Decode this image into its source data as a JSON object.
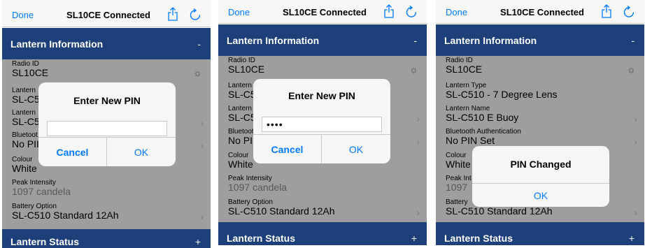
{
  "nav": {
    "done": "Done",
    "title": "SL10CE Connected",
    "share_icon": "share-icon",
    "refresh_icon": "refresh-icon"
  },
  "sections": {
    "info_label": "Lantern Information",
    "info_toggle": "-",
    "status_label": "Lantern Status",
    "status_toggle": "+"
  },
  "fields": {
    "radio_id": {
      "label": "Radio ID",
      "value": "SL10CE"
    },
    "type": {
      "label": "Lantern Type",
      "value": "SL-C510 - 7 Degree Lens"
    },
    "name": {
      "label": "Lantern Name",
      "value": "SL-C510 E Buoy"
    },
    "auth": {
      "label": "Bluetooth Authentication",
      "value": "No PIN Set"
    },
    "colour": {
      "label": "Colour",
      "value": "White"
    },
    "intensity": {
      "label": "Peak Intensity",
      "value": "1097 candela"
    },
    "battery": {
      "label": "Battery Option",
      "value": "SL-C510 Standard 12Ah"
    }
  },
  "truncated": {
    "type_label": "Lantern",
    "type_value_s1": "SL-C5",
    "type_value_s2": "SL-C5",
    "name_label": "Lantern",
    "name_value": "SL-C5",
    "auth_label": "Bluetoot",
    "auth_value_s1": "No PII",
    "auth_value_s2": "No PI",
    "colour_value_s3": "White",
    "intensity_label_s3": "Peak Int",
    "intensity_value_s3": "1097",
    "battery_label_s3": "Battery"
  },
  "dialogs": {
    "enter_pin": {
      "title": "Enter New PIN",
      "value_empty": "",
      "value_filled": "••••",
      "cancel": "Cancel",
      "ok": "OK"
    },
    "pin_changed": {
      "title": "PIN Changed",
      "ok": "OK"
    }
  },
  "colors": {
    "header_blue": "#1d3f7a",
    "ios_blue": "#007aff"
  }
}
